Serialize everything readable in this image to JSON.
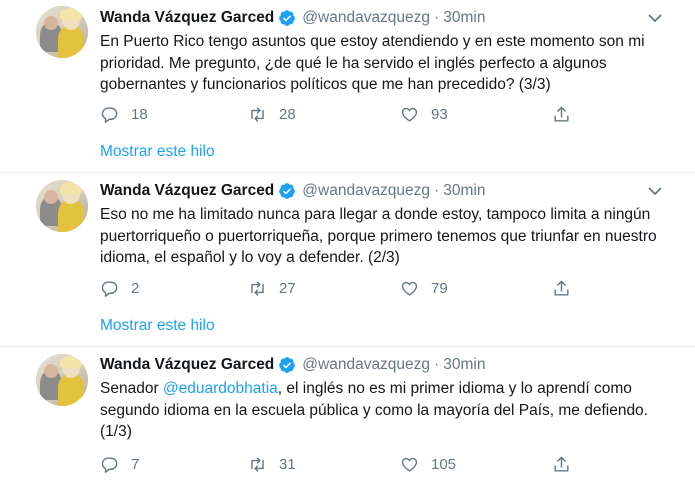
{
  "tweets": [
    {
      "name": "Wanda Vázquez Garced",
      "handle": "@wandavazquezg",
      "separator": "·",
      "time": "30min",
      "text_before": "En Puerto Rico tengo asuntos que estoy atendiendo y en este momento son mi prioridad. Me pregunto, ¿de qué le ha servido el inglés perfecto a algunos gobernantes y funcionarios políticos que me han precedido? (3/3)",
      "mention": "",
      "text_after": "",
      "replies": "18",
      "retweets": "28",
      "likes": "93",
      "show_thread": "Mostrar este hilo"
    },
    {
      "name": "Wanda Vázquez Garced",
      "handle": "@wandavazquezg",
      "separator": "·",
      "time": "30min",
      "text_before": "Eso no me ha limitado nunca para llegar a donde estoy, tampoco limita a ningún puertorriqueño o puertorriqueña, porque primero tenemos que triunfar en nuestro idioma, el español y lo voy a defender. (2/3)",
      "mention": "",
      "text_after": "",
      "replies": "2",
      "retweets": "27",
      "likes": "79",
      "show_thread": "Mostrar este hilo"
    },
    {
      "name": "Wanda Vázquez Garced",
      "handle": "@wandavazquezg",
      "separator": "·",
      "time": "30min",
      "text_before": "Senador ",
      "mention": "@eduardobhatia",
      "text_after": ", el inglés no es mi primer idioma y lo aprendí como segundo idioma en la escuela pública y como la mayoría del País, me defiendo. (1/3)",
      "replies": "7",
      "retweets": "31",
      "likes": "105",
      "show_thread": ""
    }
  ],
  "colors": {
    "accent": "#1da1f2",
    "text": "#14171a",
    "muted": "#657786",
    "border": "#e6ecf0"
  },
  "icons": [
    "verified-badge-icon",
    "chevron-down-icon",
    "reply-icon",
    "retweet-icon",
    "like-icon",
    "share-icon"
  ]
}
